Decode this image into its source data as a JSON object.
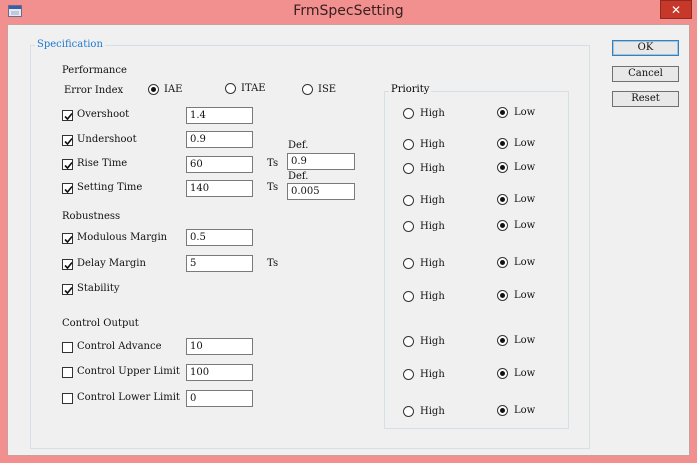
{
  "window": {
    "title": "FrmSpecSetting",
    "close_label": "✕"
  },
  "buttons": {
    "ok": "OK",
    "cancel": "Cancel",
    "reset": "Reset"
  },
  "specification": {
    "legend": "Specification",
    "performance": {
      "heading": "Performance",
      "error_index_label": "Error Index",
      "error_index_options": [
        "IAE",
        "ITAE",
        "ISE"
      ],
      "selected_error_index": "IAE",
      "overshoot": {
        "label": "Overshoot",
        "checked": true,
        "value": "1.4"
      },
      "undershoot": {
        "label": "Undershoot",
        "checked": true,
        "value": "0.9"
      },
      "rise_time": {
        "label": "Rise Time",
        "checked": true,
        "value": "60",
        "unit": "Ts",
        "def_label": "Def.",
        "def_value": "0.9"
      },
      "setting_time": {
        "label": "Setting Time",
        "checked": true,
        "value": "140",
        "unit": "Ts",
        "def_label": "Def.",
        "def_value": "0.005"
      }
    },
    "robustness": {
      "heading": "Robustness",
      "modulous_margin": {
        "label": "Modulous Margin",
        "checked": true,
        "value": "0.5"
      },
      "delay_margin": {
        "label": "Delay Margin",
        "checked": true,
        "value": "5",
        "unit": "Ts"
      },
      "stability": {
        "label": "Stability",
        "checked": true
      }
    },
    "control_output": {
      "heading": "Control Output",
      "control_advance": {
        "label": "Control Advance",
        "checked": false,
        "value": "10"
      },
      "control_upper_limit": {
        "label": "Control Upper Limit",
        "checked": false,
        "value": "100"
      },
      "control_lower_limit": {
        "label": "Control Lower Limit",
        "checked": false,
        "value": "0"
      }
    }
  },
  "priority": {
    "legend": "Priority",
    "high_label": "High",
    "low_label": "Low",
    "rows": [
      {
        "selected": "Low"
      },
      {
        "selected": "Low"
      },
      {
        "selected": "Low"
      },
      {
        "selected": "Low"
      },
      {
        "selected": "Low"
      },
      {
        "selected": "Low"
      },
      {
        "selected": "Low"
      },
      {
        "selected": "Low"
      },
      {
        "selected": "Low"
      },
      {
        "selected": "Low"
      }
    ]
  }
}
